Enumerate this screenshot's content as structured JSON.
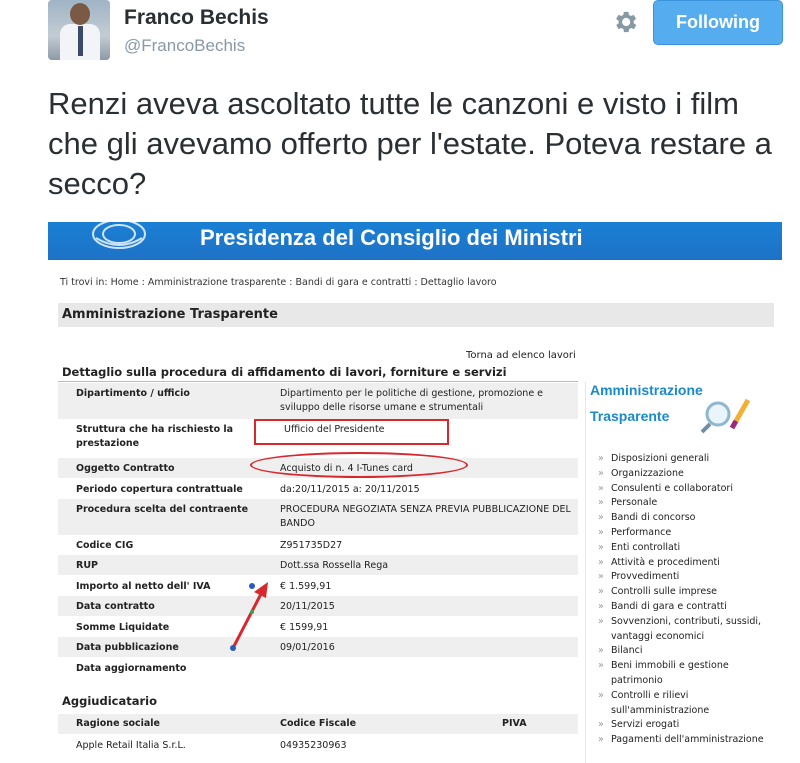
{
  "tweet": {
    "author_name": "Franco Bechis",
    "author_handle": "@FrancoBechis",
    "follow_label": "Following",
    "text": "Renzi aveva ascoltato tutte le canzoni e visto i film che gli avevamo offerto per l'estate. Poteva restare a secco?",
    "accent_color": "#55acee"
  },
  "screenshot": {
    "banner_title": "Presidenza del Consiglio dei Ministri",
    "breadcrumb": "Ti trovi in: Home : Amministrazione trasparente : Bandi di gara e contratti : Dettaglio lavoro",
    "section_title": "Amministrazione Trasparente",
    "back_link": "Torna ad elenco lavori",
    "detail_title": "Dettaglio sulla procedura di affidamento di lavori, forniture e servizi",
    "rows": [
      {
        "label": "Dipartimento / ufficio",
        "value": "Dipartimento per le politiche di gestione, promozione e sviluppo delle risorse umane e strumentali"
      },
      {
        "label": "Struttura che ha rischiesto la prestazione",
        "value": "Ufficio del Presidente"
      },
      {
        "label": "Oggetto Contratto",
        "value": "Acquisto di n. 4 I-Tunes card"
      },
      {
        "label": "Periodo copertura contrattuale",
        "value": "da:20/11/2015 a: 20/11/2015"
      },
      {
        "label": "Procedura scelta del contraente",
        "value": "PROCEDURA NEGOZIATA SENZA PREVIA PUBBLICAZIONE DEL BANDO"
      },
      {
        "label": "Codice CIG",
        "value": "Z951735D27"
      },
      {
        "label": "RUP",
        "value": "Dott.ssa Rossella Rega"
      },
      {
        "label": "Importo al netto dell' IVA",
        "value": "€ 1.599,91"
      },
      {
        "label": "Data contratto",
        "value": "20/11/2015"
      },
      {
        "label": "Somme Liquidate",
        "value": "€ 1599,91"
      },
      {
        "label": "Data pubblicazione",
        "value": "09/01/2016"
      },
      {
        "label": "Data aggiornamento",
        "value": ""
      }
    ],
    "aggiudicatario": {
      "title": "Aggiudicatario",
      "headers": [
        "Ragione sociale",
        "Codice Fiscale",
        "PIVA"
      ],
      "values": [
        "Apple Retail Italia S.r.L.",
        "04935230963",
        ""
      ]
    },
    "sidebar": {
      "title_line1": "Amministrazione",
      "title_line2": "Trasparente",
      "items": [
        "Disposizioni generali",
        "Organizzazione",
        "Consulenti e collaboratori",
        "Personale",
        "Bandi di concorso",
        "Performance",
        "Enti controllati",
        "Attività e procedimenti",
        "Provvedimenti",
        "Controlli sulle imprese",
        "Bandi di gara e contratti",
        "Sovvenzioni, contributi, sussidi, vantaggi economici",
        "Bilanci",
        "Beni immobili e gestione patrimonio",
        "Controlli e rilievi sull'amministrazione",
        "Servizi erogati",
        "Pagamenti dell'amministrazione"
      ]
    },
    "annotation_color": "#d8282e"
  }
}
